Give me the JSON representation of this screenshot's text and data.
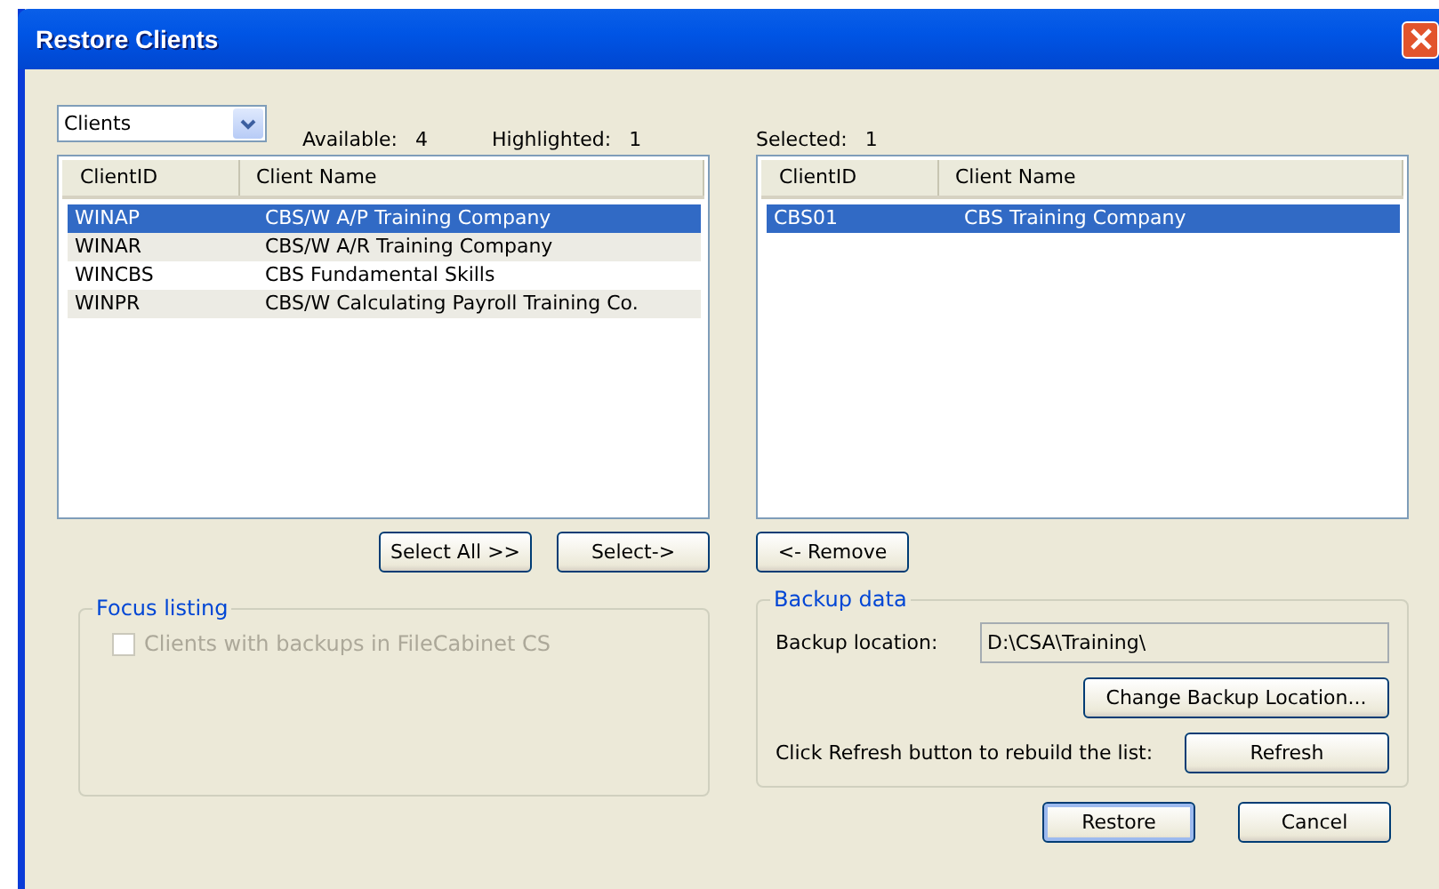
{
  "window": {
    "title": "Restore Clients"
  },
  "filter": {
    "value": "Clients"
  },
  "available": {
    "label": "Available:",
    "count": "4"
  },
  "highlighted": {
    "label": "Highlighted:",
    "count": "1"
  },
  "selected_count": {
    "label": "Selected:",
    "count": "1"
  },
  "available_list": {
    "columns": [
      "ClientID",
      "Client Name"
    ],
    "rows": [
      {
        "id": "WINAP",
        "name": "CBS/W A/P Training Company",
        "selected": true
      },
      {
        "id": "WINAR",
        "name": "CBS/W A/R Training Company",
        "selected": false
      },
      {
        "id": "WINCBS",
        "name": "CBS Fundamental Skills",
        "selected": false
      },
      {
        "id": "WINPR",
        "name": "CBS/W Calculating Payroll Training Co.",
        "selected": false
      }
    ]
  },
  "selected_list": {
    "columns": [
      "ClientID",
      "Client Name"
    ],
    "rows": [
      {
        "id": "CBS01",
        "name": "CBS Training Company",
        "selected": true
      }
    ]
  },
  "list_buttons": [
    "Select All >>",
    "Select->"
  ],
  "remove_button": "<- Remove",
  "focus_listing": {
    "title": "Focus listing",
    "checkbox": {
      "label": "Clients with backups in FileCabinet CS",
      "checked": false,
      "disabled": true
    }
  },
  "backup_data": {
    "title": "Backup data",
    "location_label": "Backup location:",
    "location_value": "D:\\CSA\\Training\\",
    "change_button": "Change Backup Location...",
    "refresh_hint": "Click Refresh button to rebuild the list:",
    "refresh_button": "Refresh"
  },
  "dialog_buttons": [
    {
      "label": "Restore",
      "default": true
    },
    {
      "label": "Cancel",
      "default": false
    }
  ]
}
